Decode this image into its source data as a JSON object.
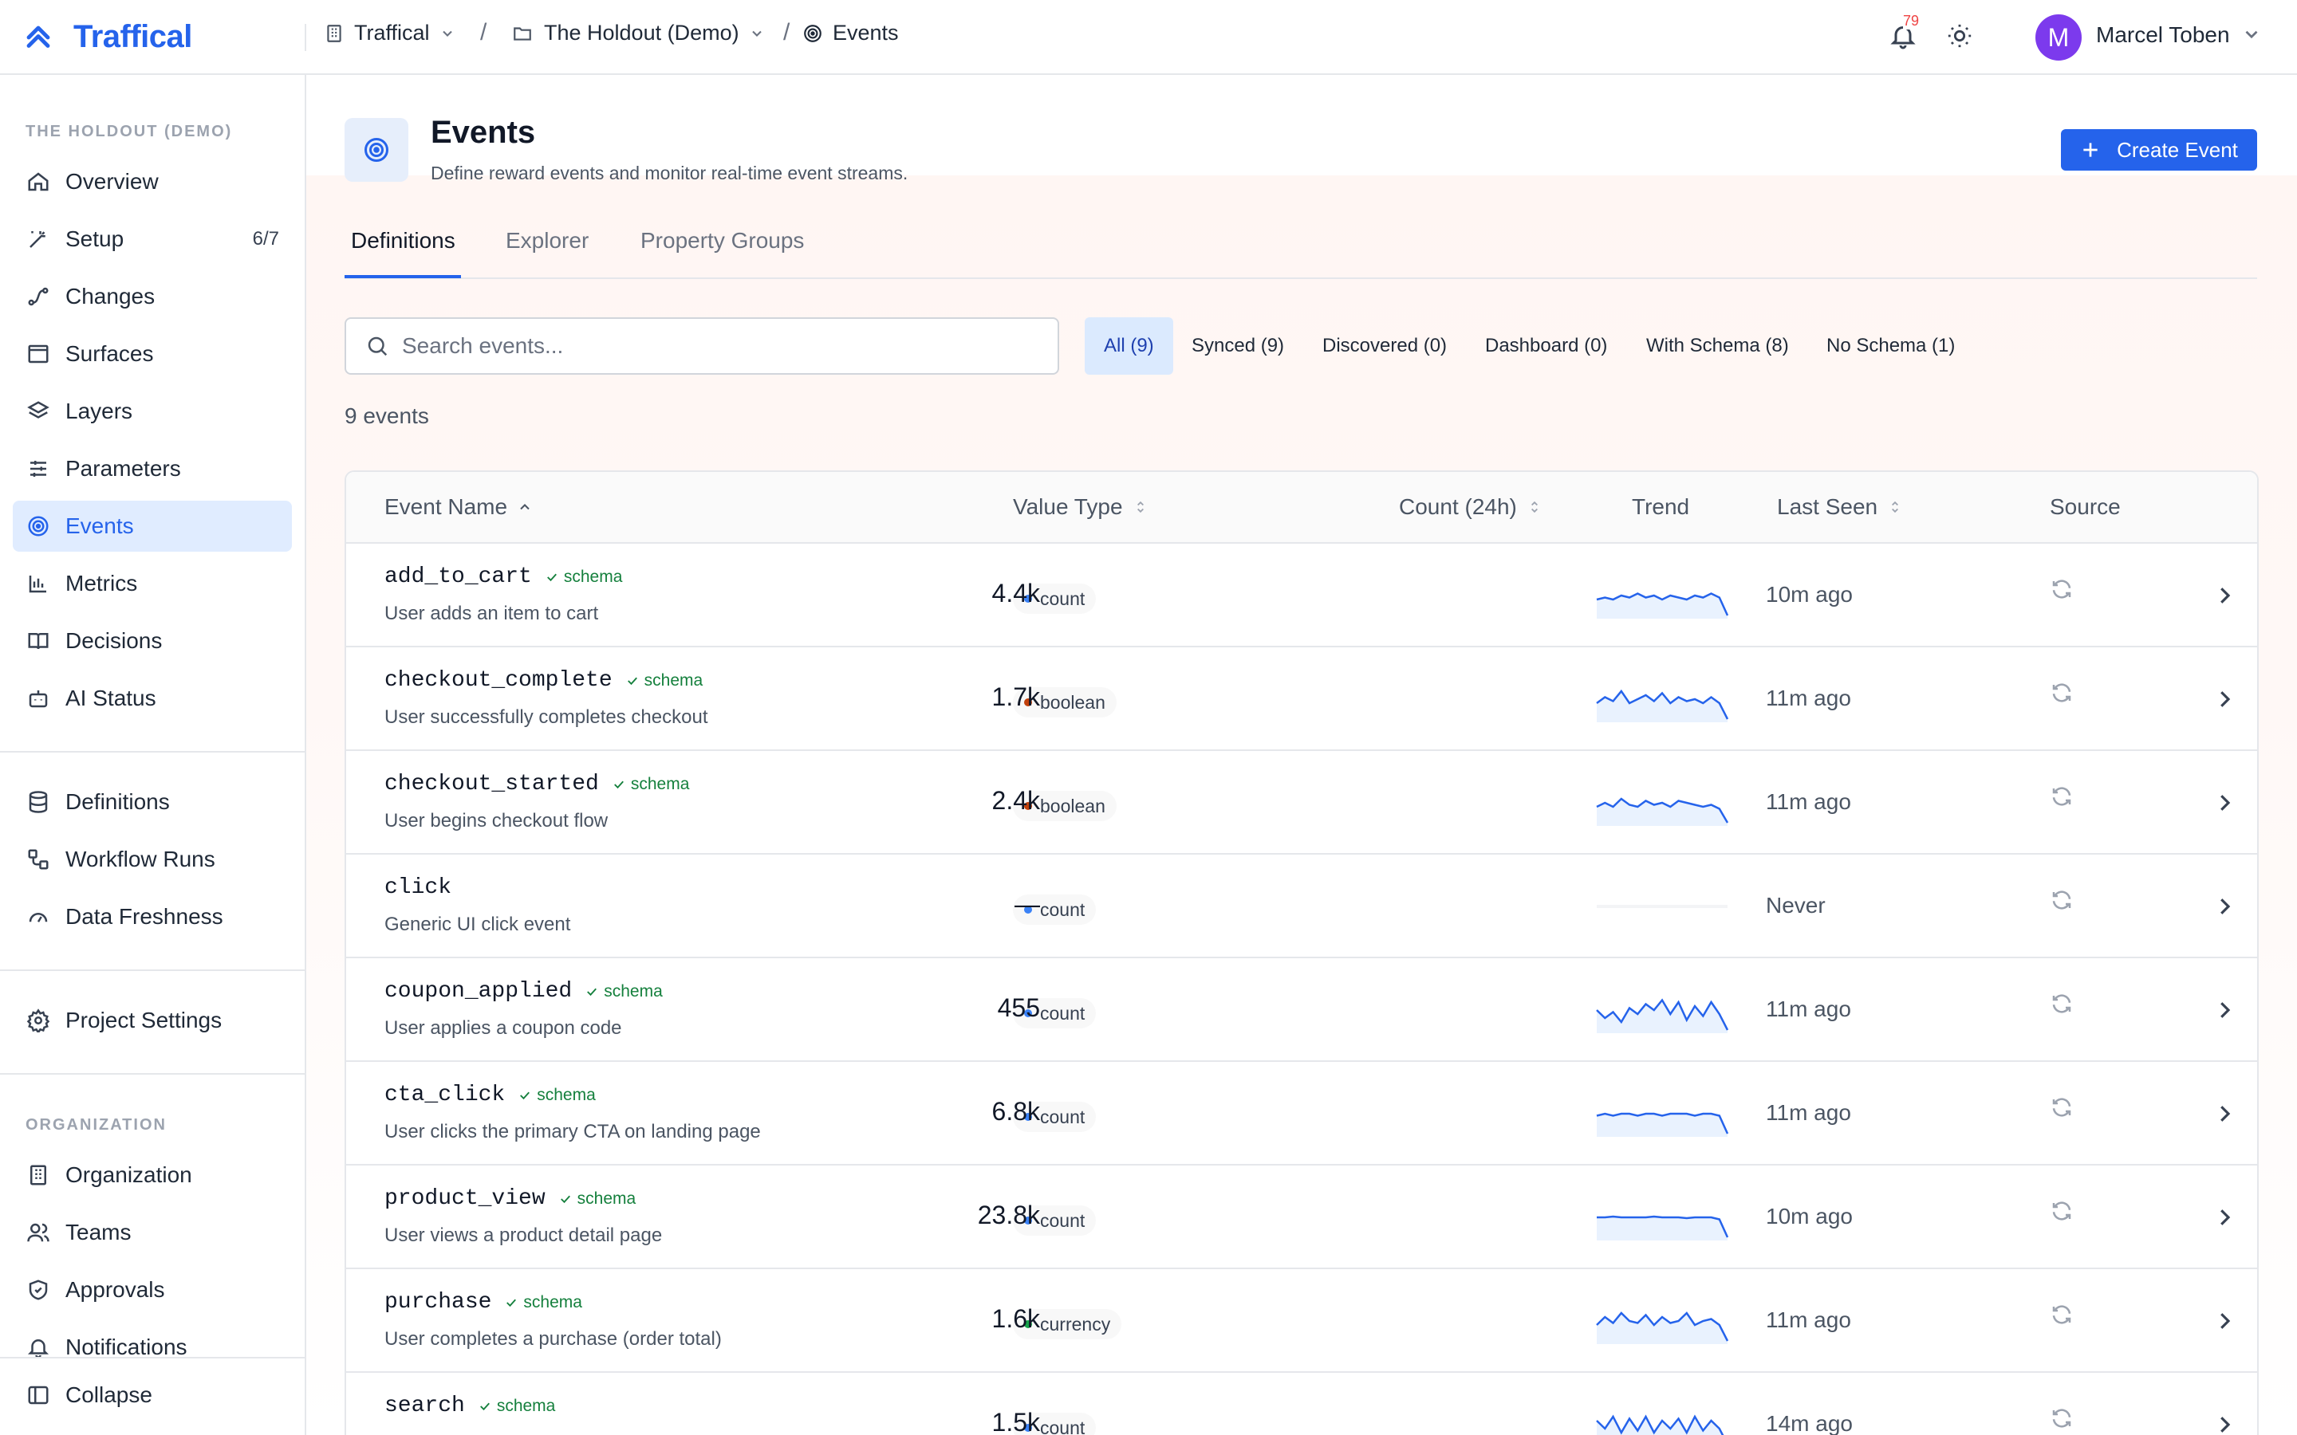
{
  "brand": {
    "name": "Traffical",
    "color": "#2563eb"
  },
  "topbar": {
    "breadcrumbs": [
      {
        "label": "Traffical",
        "icon": "building-icon"
      },
      {
        "label": "The Holdout (Demo)",
        "icon": "folder-icon"
      },
      {
        "label": "Events",
        "icon": "target-icon"
      }
    ],
    "notifications_count": "79",
    "user": {
      "initial": "M",
      "name": "Marcel Toben"
    }
  },
  "sidebar": {
    "project_title": "THE HOLDOUT (DEMO)",
    "items": [
      {
        "label": "Overview",
        "icon": "home-icon"
      },
      {
        "label": "Setup",
        "icon": "wand-icon",
        "count": "6/7"
      },
      {
        "label": "Changes",
        "icon": "changes-icon"
      },
      {
        "label": "Surfaces",
        "icon": "window-icon"
      },
      {
        "label": "Layers",
        "icon": "layers-icon"
      },
      {
        "label": "Parameters",
        "icon": "sliders-icon"
      },
      {
        "label": "Events",
        "icon": "target-icon",
        "active": true
      },
      {
        "label": "Metrics",
        "icon": "bar-chart-icon"
      },
      {
        "label": "Decisions",
        "icon": "book-icon"
      },
      {
        "label": "AI Status",
        "icon": "bot-icon"
      }
    ],
    "items2": [
      {
        "label": "Definitions",
        "icon": "database-icon"
      },
      {
        "label": "Workflow Runs",
        "icon": "workflow-icon"
      },
      {
        "label": "Data Freshness",
        "icon": "gauge-icon"
      }
    ],
    "items3": [
      {
        "label": "Project Settings",
        "icon": "gear-icon"
      }
    ],
    "org_title": "ORGANIZATION",
    "org_items": [
      {
        "label": "Organization",
        "icon": "building-icon"
      },
      {
        "label": "Teams",
        "icon": "users-icon"
      },
      {
        "label": "Approvals",
        "icon": "shield-check-icon"
      },
      {
        "label": "Notifications",
        "icon": "bell-icon"
      }
    ],
    "collapse_label": "Collapse"
  },
  "page": {
    "title": "Events",
    "subtitle": "Define reward events and monitor real-time event streams.",
    "create_button": "Create Event"
  },
  "tabs": [
    "Definitions",
    "Explorer",
    "Property Groups"
  ],
  "search": {
    "placeholder": "Search events..."
  },
  "filters": [
    "All (9)",
    "Synced (9)",
    "Discovered (0)",
    "Dashboard (0)",
    "With Schema (8)",
    "No Schema (1)"
  ],
  "events_count_label": "9 events",
  "table": {
    "headers": {
      "name": "Event Name",
      "value_type": "Value Type",
      "count": "Count (24h)",
      "trend": "Trend",
      "last_seen": "Last Seen",
      "source": "Source"
    },
    "schema_label": "schema",
    "type_colors": {
      "count": "#3b82f6",
      "boolean": "#c2410c",
      "currency": "#16a34a"
    },
    "rows": [
      {
        "name": "add_to_cart",
        "schema": true,
        "desc": "User adds an item to cart",
        "type": "count",
        "count": "4.4k",
        "last": "10m ago",
        "trend": [
          0.6,
          0.55,
          0.6,
          0.5,
          0.55,
          0.45,
          0.55,
          0.5,
          0.6,
          0.5,
          0.55,
          0.6,
          0.5,
          0.55,
          0.45,
          0.55,
          1.0
        ]
      },
      {
        "name": "checkout_complete",
        "schema": true,
        "desc": "User successfully completes checkout",
        "type": "boolean",
        "count": "1.7k",
        "last": "11m ago",
        "trend": [
          0.6,
          0.45,
          0.55,
          0.3,
          0.6,
          0.5,
          0.4,
          0.55,
          0.35,
          0.6,
          0.45,
          0.55,
          0.5,
          0.6,
          0.45,
          0.6,
          1.0
        ]
      },
      {
        "name": "checkout_started",
        "schema": true,
        "desc": "User begins checkout flow",
        "type": "boolean",
        "count": "2.4k",
        "last": "11m ago",
        "trend": [
          0.6,
          0.5,
          0.6,
          0.4,
          0.55,
          0.6,
          0.45,
          0.55,
          0.5,
          0.6,
          0.45,
          0.5,
          0.55,
          0.6,
          0.55,
          0.65,
          1.0
        ]
      },
      {
        "name": "click",
        "schema": false,
        "desc": "Generic UI click event",
        "type": "count",
        "count": "—",
        "last": "Never",
        "trend": []
      },
      {
        "name": "coupon_applied",
        "schema": true,
        "desc": "User applies a coupon code",
        "type": "count",
        "count": "455",
        "last": "11m ago",
        "trend": [
          0.5,
          0.7,
          0.55,
          0.8,
          0.45,
          0.6,
          0.35,
          0.5,
          0.25,
          0.6,
          0.3,
          0.75,
          0.4,
          0.65,
          0.3,
          0.6,
          1.0
        ]
      },
      {
        "name": "cta_click",
        "schema": true,
        "desc": "User clicks the primary CTA on landing page",
        "type": "count",
        "count": "6.8k",
        "last": "11m ago",
        "trend": [
          0.55,
          0.5,
          0.55,
          0.5,
          0.5,
          0.55,
          0.5,
          0.5,
          0.55,
          0.5,
          0.5,
          0.5,
          0.55,
          0.5,
          0.5,
          0.55,
          1.0
        ]
      },
      {
        "name": "product_view",
        "schema": true,
        "desc": "User views a product detail page",
        "type": "count",
        "count": "23.8k",
        "last": "10m ago",
        "trend": [
          0.5,
          0.5,
          0.48,
          0.5,
          0.5,
          0.5,
          0.5,
          0.48,
          0.5,
          0.5,
          0.5,
          0.52,
          0.5,
          0.5,
          0.5,
          0.55,
          1.0
        ]
      },
      {
        "name": "purchase",
        "schema": true,
        "desc": "User completes a purchase (order total)",
        "type": "currency",
        "count": "1.6k",
        "last": "11m ago",
        "trend": [
          0.6,
          0.4,
          0.55,
          0.3,
          0.5,
          0.55,
          0.35,
          0.6,
          0.4,
          0.55,
          0.5,
          0.3,
          0.6,
          0.5,
          0.45,
          0.6,
          1.0
        ]
      },
      {
        "name": "search",
        "schema": true,
        "desc": "",
        "type": "count",
        "count": "1.5k",
        "last": "14m ago",
        "trend": [
          0.4,
          0.6,
          0.3,
          0.7,
          0.35,
          0.65,
          0.3,
          0.7,
          0.4,
          0.6,
          0.35,
          0.7,
          0.3,
          0.65,
          0.4,
          0.6,
          1.0
        ]
      }
    ]
  }
}
